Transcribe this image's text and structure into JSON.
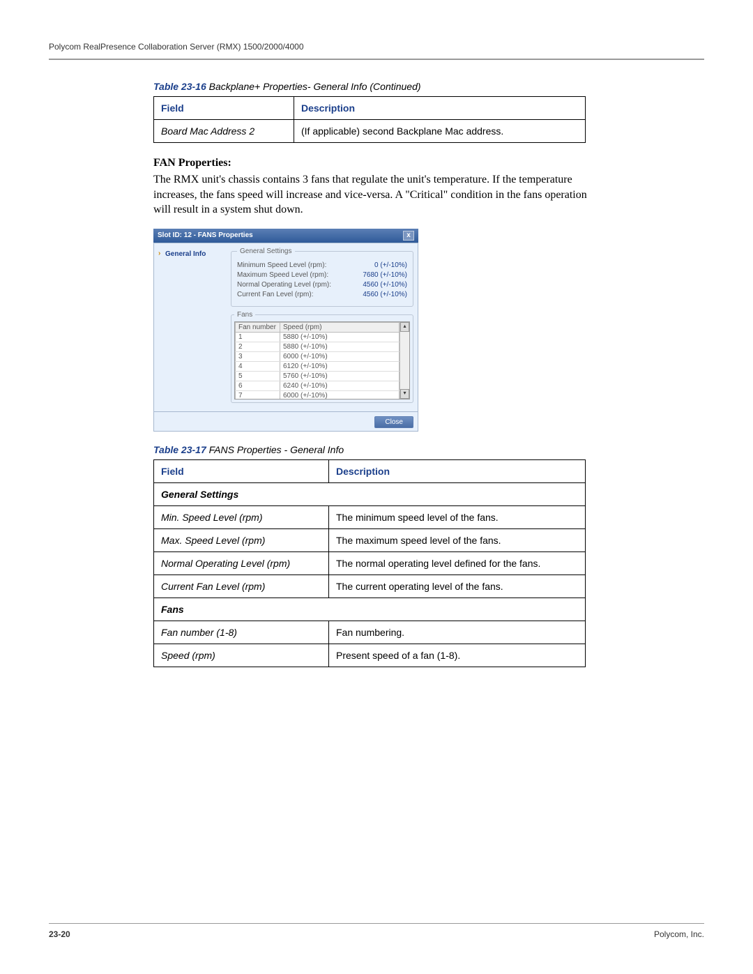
{
  "header": {
    "doc_title": "Polycom RealPresence Collaboration Server (RMX) 1500/2000/4000"
  },
  "table16": {
    "caption_num": "Table 23-16",
    "caption_text": " Backplane+ Properties- General Info (Continued)",
    "col_field": "Field",
    "col_desc": "Description",
    "row_field": "Board Mac Address 2",
    "row_desc": "(If applicable) second Backplane Mac address."
  },
  "fan_section": {
    "heading": "FAN Properties:",
    "paragraph": "The RMX unit's chassis contains 3 fans that regulate the unit's temperature. If the temperature increases, the fans speed will increase and vice-versa. A \"Critical\" condition in the fans operation will result in a system shut down."
  },
  "dialog": {
    "title": "Slot ID: 12 - FANS Properties",
    "nav_item": "General Info",
    "legend_general": "General Settings",
    "legend_fans": "Fans",
    "close_label": "Close",
    "settings": [
      {
        "label": "Minimum Speed Level (rpm):",
        "value": "0  (+/-10%)"
      },
      {
        "label": "Maximum Speed Level (rpm):",
        "value": "7680  (+/-10%)"
      },
      {
        "label": "Normal Operating Level (rpm):",
        "value": "4560  (+/-10%)"
      },
      {
        "label": "Current Fan Level (rpm):",
        "value": "4560  (+/-10%)"
      }
    ],
    "fan_headers": {
      "num": "Fan number",
      "speed": "Speed (rpm)"
    },
    "fans": [
      {
        "n": "1",
        "s": "5880 (+/-10%)"
      },
      {
        "n": "2",
        "s": "5880 (+/-10%)"
      },
      {
        "n": "3",
        "s": "6000 (+/-10%)"
      },
      {
        "n": "4",
        "s": "6120 (+/-10%)"
      },
      {
        "n": "5",
        "s": "5760 (+/-10%)"
      },
      {
        "n": "6",
        "s": "6240 (+/-10%)"
      },
      {
        "n": "7",
        "s": "6000 (+/-10%)"
      }
    ]
  },
  "table17": {
    "caption_num": "Table 23-17",
    "caption_text": " FANS Properties - General Info",
    "col_field": "Field",
    "col_desc": "Description",
    "section1": "General Settings",
    "rows1": [
      {
        "f": "Min. Speed Level (rpm)",
        "d": "The minimum speed level of the fans."
      },
      {
        "f": "Max. Speed Level (rpm)",
        "d": "The maximum speed level of the fans."
      },
      {
        "f": "Normal Operating Level (rpm)",
        "d": "The normal operating level defined for the fans."
      },
      {
        "f": "Current Fan Level (rpm)",
        "d": "The current operating level of the fans."
      }
    ],
    "section2": "Fans",
    "rows2": [
      {
        "f": "Fan number (1-8)",
        "d": "Fan numbering."
      },
      {
        "f": "Speed (rpm)",
        "d": "Present speed of a fan (1-8)."
      }
    ]
  },
  "footer": {
    "page": "23-20",
    "company": "Polycom, Inc."
  }
}
